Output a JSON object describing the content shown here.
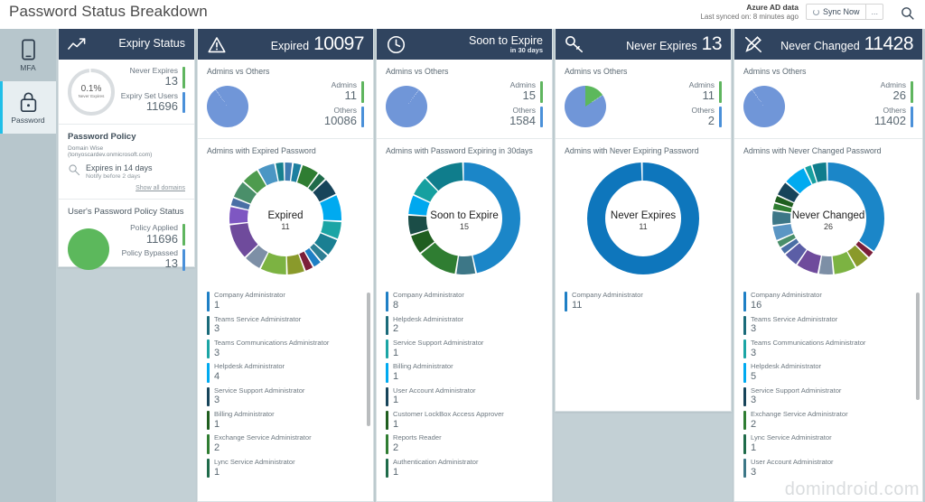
{
  "header": {
    "title": "Password Status Breakdown",
    "sync": {
      "title": "Azure AD data",
      "subtitle": "Last synced on: 8 minutes ago",
      "button_label": "Sync Now",
      "more_label": "...",
      "spinner_icon": "spinner-icon",
      "search_icon": "search-icon"
    }
  },
  "sidebar": {
    "items": [
      {
        "label": "MFA",
        "icon": "mobile-phone-icon",
        "active": false
      },
      {
        "label": "Password",
        "icon": "lock-icon",
        "active": true
      }
    ]
  },
  "colors": {
    "header_bg": "#30445f",
    "accent_blue": "#1b86c8",
    "accent_green": "#5fb55f",
    "pie_blue": "#7096d8",
    "pie_green": "#5cb85c",
    "nav_bg": "#b7c6cc",
    "board_bg": "#c3d0d5",
    "active_marker": "#21bfe8"
  },
  "columns": [
    {
      "id": "expiry-status",
      "head": {
        "icon": "trending-up-icon",
        "label": "Expiry Status",
        "sub": "",
        "number": ""
      },
      "ring": {
        "percent": "0.1%",
        "caption": "Never Expires",
        "value": 0.1
      },
      "stats": [
        {
          "name": "Never Expires",
          "value": "13",
          "color": "#5fb55f"
        },
        {
          "name": "Expiry Set Users",
          "value": "11696",
          "color": "#4a90d9"
        }
      ],
      "policy": {
        "section_title": "Password Policy",
        "domain_line": "Domain Wise (tonyoscardev.onmicrosoft.com)",
        "icon": "search-key-icon",
        "main": "Expires in 14 days",
        "note": "Notify before 2 days",
        "show_all": "Show all domains"
      },
      "user_policy": {
        "title": "User's Password Policy Status",
        "pie_color": "#5cb85c",
        "stats": [
          {
            "name": "Policy Applied",
            "value": "11696",
            "color": "#5fb55f"
          },
          {
            "name": "Policy Bypassed",
            "value": "13",
            "color": "#4a90d9"
          }
        ]
      }
    },
    {
      "id": "expired",
      "head": {
        "icon": "warning-triangle-icon",
        "label": "Expired",
        "sub": "",
        "number": "10097"
      },
      "admins_vs_others": {
        "title": "Admins vs Others",
        "pie_color": "#7096d8",
        "pie_split": 0.1,
        "stats": [
          {
            "name": "Admins",
            "value": "11",
            "color": "#5fb55f"
          },
          {
            "name": "Others",
            "value": "10086",
            "color": "#4a90d9"
          }
        ]
      },
      "donut": {
        "section_title": "Admins with Expired Password",
        "center_title": "Expired",
        "center_value": "11",
        "segments": [
          {
            "value": 1,
            "color": "#3e7cb1"
          },
          {
            "value": 1,
            "color": "#1d7fa0"
          },
          {
            "value": 2,
            "color": "#2f7d32"
          },
          {
            "value": 1,
            "color": "#1f6b4a"
          },
          {
            "value": 2,
            "color": "#17445a"
          },
          {
            "value": 3,
            "color": "#00aaf0"
          },
          {
            "value": 2,
            "color": "#1ba5a5"
          },
          {
            "value": 2,
            "color": "#1a7f92"
          },
          {
            "value": 1,
            "color": "#2d7f94"
          },
          {
            "value": 1,
            "color": "#1e7fc5"
          },
          {
            "value": 1,
            "color": "#7b1f3a"
          },
          {
            "value": 2,
            "color": "#8a9a2b"
          },
          {
            "value": 3,
            "color": "#7cb342"
          },
          {
            "value": 2,
            "color": "#7d8fa6"
          },
          {
            "value": 4,
            "color": "#6f4b9c"
          },
          {
            "value": 2,
            "color": "#7e57c2"
          },
          {
            "value": 1,
            "color": "#4a6fa5"
          },
          {
            "value": 2,
            "color": "#4a8f6a"
          },
          {
            "value": 2,
            "color": "#4e9b4e"
          },
          {
            "value": 2,
            "color": "#4b96c4"
          },
          {
            "value": 1,
            "color": "#17808f"
          }
        ]
      },
      "roles": [
        {
          "name": "Company Administrator",
          "value": "1",
          "color": "#1e7fc5"
        },
        {
          "name": "Teams Service Administrator",
          "value": "3",
          "color": "#1a6b7a"
        },
        {
          "name": "Teams Communications Administrator",
          "value": "3",
          "color": "#1ba5a5"
        },
        {
          "name": "Helpdesk Administrator",
          "value": "4",
          "color": "#00aaf0"
        },
        {
          "name": "Service Support Administrator",
          "value": "3",
          "color": "#17445a"
        },
        {
          "name": "Billing Administrator",
          "value": "1",
          "color": "#1f5e1f"
        },
        {
          "name": "Exchange Service Administrator",
          "value": "2",
          "color": "#2f7d32"
        },
        {
          "name": "Lync Service Administrator",
          "value": "1",
          "color": "#1f6b4a"
        }
      ],
      "scroll": {
        "visible": true,
        "top_pct": 2,
        "height_pct": 62
      }
    },
    {
      "id": "soon-to-expire",
      "head": {
        "icon": "clock-icon",
        "label": "Soon to Expire",
        "sub": "in 30 days",
        "number": ""
      },
      "admins_vs_others": {
        "title": "Admins vs Others",
        "pie_color": "#7096d8",
        "pie_split": 0.9,
        "stats": [
          {
            "name": "Admins",
            "value": "15",
            "color": "#5fb55f"
          },
          {
            "name": "Others",
            "value": "1584",
            "color": "#4a90d9"
          }
        ]
      },
      "donut": {
        "section_title": "Admins with Password Expiring in 30days",
        "center_title": "Soon to Expire",
        "center_value": "15",
        "segments": [
          {
            "value": 8,
            "color": "#1b86c8"
          },
          {
            "value": 1,
            "color": "#3d7787"
          },
          {
            "value": 2,
            "color": "#2f7d32"
          },
          {
            "value": 1,
            "color": "#1f5e1f"
          },
          {
            "value": 1,
            "color": "#1b4d47"
          },
          {
            "value": 1,
            "color": "#00a8ef"
          },
          {
            "value": 1,
            "color": "#16a0a0"
          },
          {
            "value": 2,
            "color": "#0f7d8c"
          }
        ]
      },
      "roles": [
        {
          "name": "Company Administrator",
          "value": "8",
          "color": "#1e7fc5"
        },
        {
          "name": "Helpdesk Administrator",
          "value": "2",
          "color": "#1a6b7a"
        },
        {
          "name": "Service Support Administrator",
          "value": "1",
          "color": "#1ba5a5"
        },
        {
          "name": "Billing Administrator",
          "value": "1",
          "color": "#00aaf0"
        },
        {
          "name": "User Account Administrator",
          "value": "1",
          "color": "#17445a"
        },
        {
          "name": "Customer LockBox Access Approver",
          "value": "1",
          "color": "#1f5e1f"
        },
        {
          "name": "Reports Reader",
          "value": "2",
          "color": "#2f7d32"
        },
        {
          "name": "Authentication Administrator",
          "value": "1",
          "color": "#1f6b4a"
        }
      ],
      "scroll": {
        "visible": false,
        "top_pct": 2,
        "height_pct": 60
      }
    },
    {
      "id": "never-expires",
      "head": {
        "icon": "key-icon",
        "label": "Never Expires",
        "sub": "",
        "number": "13"
      },
      "admins_vs_others": {
        "title": "Admins vs Others",
        "pie_color": "#5cb85c",
        "pie_split": 0.845,
        "stats": [
          {
            "name": "Admins",
            "value": "11",
            "color": "#5fb55f"
          },
          {
            "name": "Others",
            "value": "2",
            "color": "#4a90d9"
          }
        ]
      },
      "donut": {
        "section_title": "Admins with Never Expiring Password",
        "center_title": "Never Expires",
        "center_value": "11",
        "segments": [
          {
            "value": 11,
            "color": "#0e76bc"
          }
        ]
      },
      "roles": [
        {
          "name": "Company Administrator",
          "value": "11",
          "color": "#1e7fc5"
        }
      ],
      "scroll": {
        "visible": false,
        "top_pct": 0,
        "height_pct": 0
      }
    },
    {
      "id": "never-changed",
      "head": {
        "icon": "pen-slash-icon",
        "label": "Never Changed",
        "sub": "",
        "number": "11428"
      },
      "admins_vs_others": {
        "title": "Admins vs Others",
        "pie_color": "#7096d8",
        "pie_split": 0.1,
        "stats": [
          {
            "name": "Admins",
            "value": "26",
            "color": "#5fb55f"
          },
          {
            "name": "Others",
            "value": "11402",
            "color": "#4a90d9"
          }
        ]
      },
      "donut": {
        "section_title": "Admins with Never Changed Password",
        "center_title": "Never Changed",
        "center_value": "26",
        "segments": [
          {
            "value": 16,
            "color": "#1b86c8"
          },
          {
            "value": 1,
            "color": "#7b1f3a"
          },
          {
            "value": 2,
            "color": "#8a9a2b"
          },
          {
            "value": 3,
            "color": "#7cb342"
          },
          {
            "value": 2,
            "color": "#7d8fa6"
          },
          {
            "value": 3,
            "color": "#6f4b9c"
          },
          {
            "value": 2,
            "color": "#5b5ea6"
          },
          {
            "value": 1,
            "color": "#4a6fa5"
          },
          {
            "value": 1,
            "color": "#4a8f6a"
          },
          {
            "value": 2,
            "color": "#5b96c4"
          },
          {
            "value": 2,
            "color": "#3d7787"
          },
          {
            "value": 1,
            "color": "#2f7d32"
          },
          {
            "value": 1,
            "color": "#1f5e1f"
          },
          {
            "value": 2,
            "color": "#17445a"
          },
          {
            "value": 3,
            "color": "#00aaf0"
          },
          {
            "value": 1,
            "color": "#16a0a0"
          },
          {
            "value": 2,
            "color": "#0f7d8c"
          }
        ]
      },
      "roles": [
        {
          "name": "Company Administrator",
          "value": "16",
          "color": "#1e7fc5"
        },
        {
          "name": "Teams Service Administrator",
          "value": "3",
          "color": "#1a6b7a"
        },
        {
          "name": "Teams Communications Administrator",
          "value": "3",
          "color": "#1ba5a5"
        },
        {
          "name": "Helpdesk Administrator",
          "value": "5",
          "color": "#00aaf0"
        },
        {
          "name": "Service Support Administrator",
          "value": "3",
          "color": "#17445a"
        },
        {
          "name": "Exchange Service Administrator",
          "value": "2",
          "color": "#2f7d32"
        },
        {
          "name": "Lync Service Administrator",
          "value": "1",
          "color": "#1f6b4a"
        },
        {
          "name": "User Account Administrator",
          "value": "3",
          "color": "#3d7787"
        }
      ],
      "scroll": {
        "visible": true,
        "top_pct": 2,
        "height_pct": 50
      }
    }
  ],
  "watermark": "domindroid.com"
}
